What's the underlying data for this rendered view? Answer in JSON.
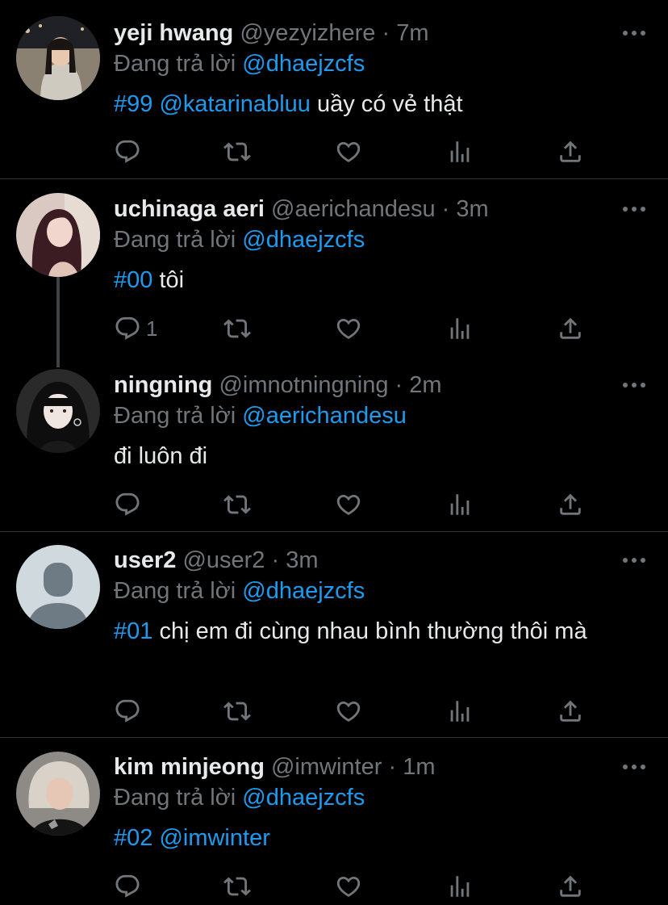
{
  "colors": {
    "background": "#000000",
    "text": "#e7e9ea",
    "muted": "#71767b",
    "accent": "#1d9bf0",
    "divider": "#2f3336"
  },
  "icons": [
    "reply-icon",
    "retweet-icon",
    "like-icon",
    "analytics-icon",
    "share-icon",
    "more-icon"
  ],
  "tweets": [
    {
      "name": "yeji hwang",
      "handle": "@yezyizhere",
      "sep": "·",
      "time": "7m",
      "reply_prefix": "Đang trả lời",
      "reply_to": "@dhaejzcfs",
      "tag": "#99",
      "mention": "@katarinabluu",
      "text": "uầy có vẻ thật",
      "reply_count": ""
    },
    {
      "name": "uchinaga aeri",
      "handle": "@aerichandesu",
      "sep": "·",
      "time": "3m",
      "reply_prefix": "Đang trả lời",
      "reply_to": "@dhaejzcfs",
      "tag": "#00",
      "mention": "",
      "text": "tôi",
      "reply_count": "1"
    },
    {
      "name": "ningning",
      "handle": "@imnotningning",
      "sep": "·",
      "time": "2m",
      "reply_prefix": "Đang trả lời",
      "reply_to": "@aerichandesu",
      "tag": "",
      "mention": "",
      "text": "đi luôn đi",
      "reply_count": ""
    },
    {
      "name": "user2",
      "handle": "@user2",
      "sep": "·",
      "time": "3m",
      "reply_prefix": "Đang trả lời",
      "reply_to": "@dhaejzcfs",
      "tag": "#01",
      "mention": "",
      "text": "chị em đi cùng nhau bình thường thôi mà",
      "reply_count": ""
    },
    {
      "name": "kim minjeong",
      "handle": "@imwinter",
      "sep": "·",
      "time": "1m",
      "reply_prefix": "Đang trả lời",
      "reply_to": "@dhaejzcfs",
      "tag": "#02",
      "mention": "@imwinter",
      "text": "",
      "reply_count": ""
    }
  ]
}
